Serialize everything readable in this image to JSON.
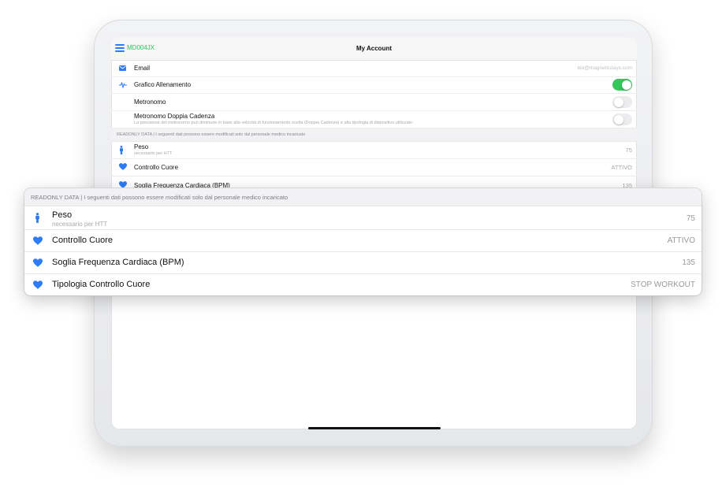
{
  "header": {
    "user_code": "MD004JX",
    "title": "My Account"
  },
  "settings": {
    "email_label": "Email",
    "email_value": "bio@magneticdays.com",
    "grafico_label": "Grafico Allenamento",
    "grafico_on": true,
    "metronomo_label": "Metronomo",
    "metronomo_on": false,
    "doppia_label": "Metronomo Doppia Cadenza",
    "doppia_desc": "La precisione del metronomo può diminuire in base alla velocità di funzionamento scelta (Doppia Cadenza) e alla tipologia di dispositivo utilizzato",
    "doppia_on": false
  },
  "readonly": {
    "header": "READONLY DATA | I seguenti dati possono essere modificati solo dal personale medico incaricato",
    "rows": [
      {
        "label": "Peso",
        "sub": "necessario per HTT",
        "value": "75",
        "icon": "person-icon"
      },
      {
        "label": "Controllo Cuore",
        "value": "ATTIVO",
        "icon": "heart-icon"
      },
      {
        "label": "Soglia Frequenza Cardiaca (BPM)",
        "value": "135",
        "icon": "heart-icon"
      },
      {
        "label": "Tipologia Controllo Cuore",
        "value": "STOP WORKOUT",
        "icon": "heart-icon"
      }
    ]
  },
  "colors": {
    "accent_blue": "#2b7cf6",
    "accent_green": "#34c759",
    "user_code_green": "#31c25a"
  }
}
